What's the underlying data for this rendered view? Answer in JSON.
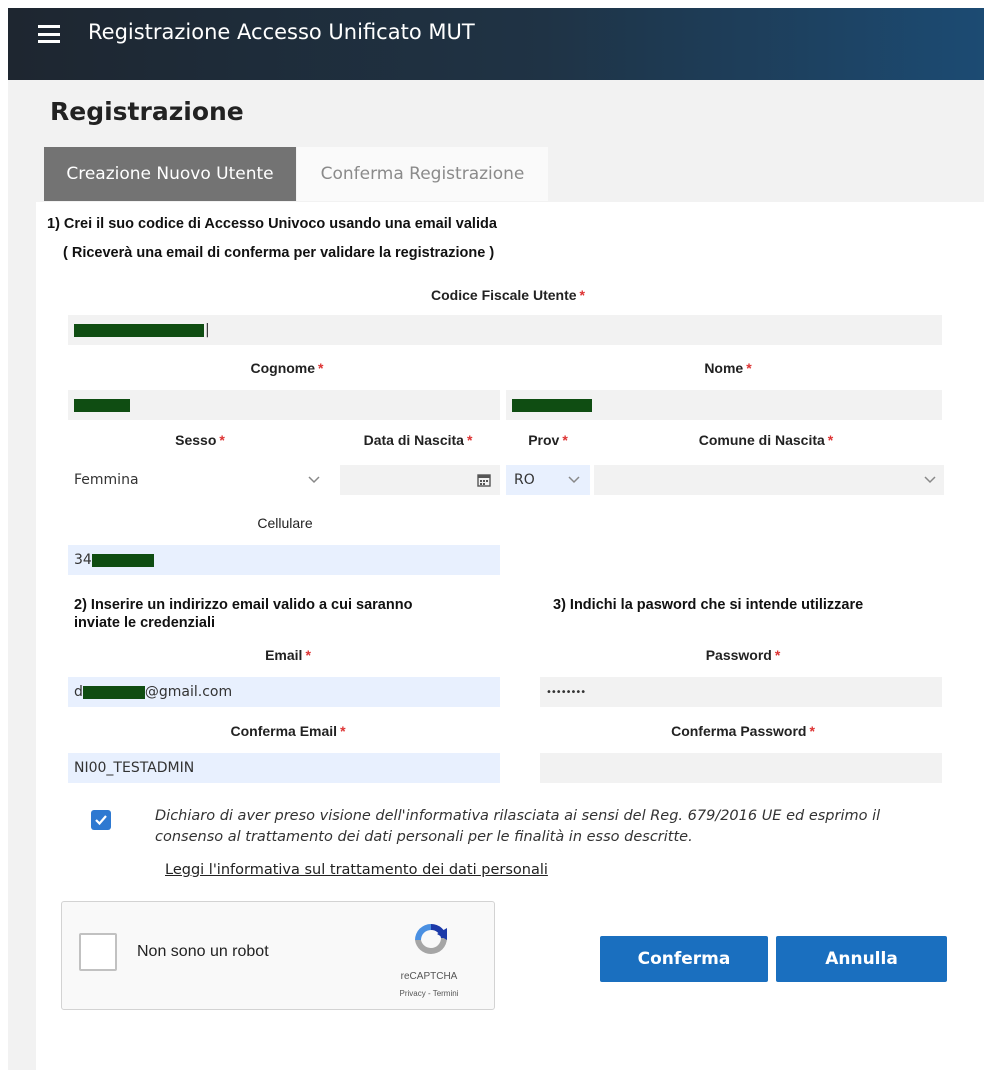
{
  "header": {
    "app_title": "Registrazione Accesso Unificato MUT",
    "menu_icon": "hamburger-menu-icon"
  },
  "page": {
    "title": "Registrazione"
  },
  "tabs": [
    {
      "label": "Creazione Nuovo Utente",
      "active": true
    },
    {
      "label": "Conferma Registrazione",
      "active": false
    }
  ],
  "section1": {
    "line1": "1) Crei il suo codice di Accesso Univoco usando una email valida",
    "line2": "( Riceverà una email di conferma per validare la registrazione )"
  },
  "fields": {
    "codice_fiscale": {
      "label": "Codice Fiscale Utente",
      "value": ""
    },
    "cognome": {
      "label": "Cognome",
      "value": ""
    },
    "nome": {
      "label": "Nome",
      "value": ""
    },
    "sesso": {
      "label": "Sesso",
      "value": "Femmina"
    },
    "data_nascita": {
      "label": "Data di Nascita",
      "value": ""
    },
    "prov": {
      "label": "Prov",
      "value": "RO"
    },
    "comune": {
      "label": "Comune di Nascita",
      "value": ""
    },
    "cellulare": {
      "label": "Cellulare",
      "value_prefix": "34"
    },
    "email": {
      "label": "Email",
      "value_prefix": "d",
      "value_suffix": "@gmail.com"
    },
    "conferma_email": {
      "label": "Conferma Email",
      "value": "NI00_TESTADMIN"
    },
    "password": {
      "label": "Password",
      "value": "••••••••"
    },
    "conferma_password": {
      "label": "Conferma Password",
      "value": ""
    }
  },
  "required_marker": "*",
  "section2": {
    "line1": "2) Inserire un indirizzo email valido a cui saranno",
    "line2": "inviate le credenziali"
  },
  "section3": {
    "line1": "3) Indichi la pasword che si intende utilizzare"
  },
  "consent": {
    "checked": true,
    "line1": "Dichiaro di aver preso visione dell'informativa rilasciata ai sensi del Reg. 679/2016 UE ed esprimo il",
    "line2": "consenso al trattamento dei dati personali per le finalità in esso descritte.",
    "link": "Leggi l'informativa sul trattamento dei dati personali"
  },
  "recaptcha": {
    "label": "Non sono un robot",
    "brand": "reCAPTCHA",
    "terms": "Privacy - Termini"
  },
  "buttons": {
    "confirm": "Conferma",
    "cancel": "Annulla"
  },
  "colors": {
    "primary_button": "#1a6fbf",
    "checkbox": "#2e79d1",
    "required": "#d33333"
  }
}
